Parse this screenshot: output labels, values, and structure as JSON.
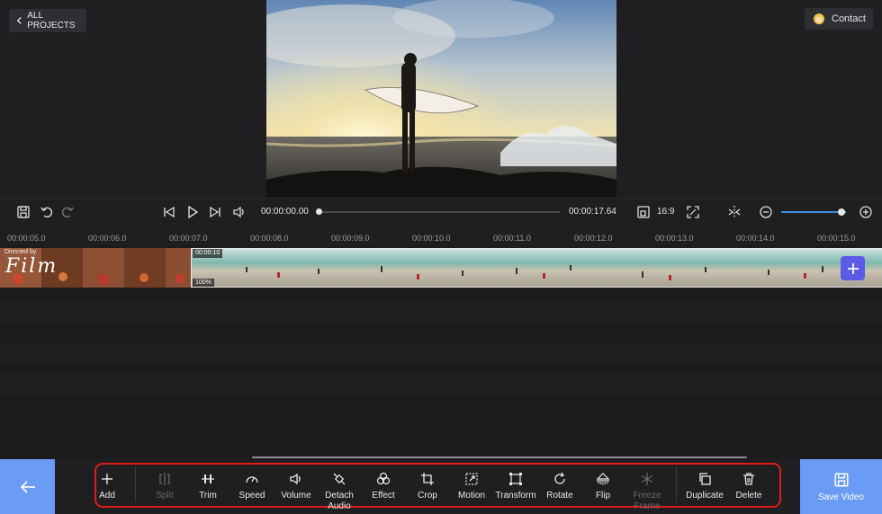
{
  "header": {
    "back_label": "ALL PROJECTS",
    "contact_label": "Contact"
  },
  "player": {
    "current_time": "00:00:00.00",
    "total_time": "00:00:17.64",
    "aspect_ratio": "16:9",
    "playhead_fraction": 0.0,
    "zoom_fraction": 0.93
  },
  "ruler": {
    "labels": [
      "00:00:05.0",
      "00:00:06.0",
      "00:00:07.0",
      "00:00:08.0",
      "00:00:09.0",
      "00:00:10.0",
      "00:00:11.0",
      "00:00:12.0",
      "00:00:13.0",
      "00:00:14.0",
      "00:00:15.0"
    ]
  },
  "timeline": {
    "clip1_text": "Directed by",
    "clip1_title": "Film",
    "clip2_duration": "00:00:10",
    "clip2_volume": "100%"
  },
  "toolbar": {
    "add": "Add",
    "split": "Split",
    "trim": "Trim",
    "speed": "Speed",
    "volume": "Volume",
    "detach_audio": "Detach Audio",
    "effect": "Effect",
    "crop": "Crop",
    "motion": "Motion",
    "transform": "Transform",
    "rotate": "Rotate",
    "flip": "Flip",
    "freeze_frame": "Freeze Frame",
    "duplicate": "Duplicate",
    "delete": "Delete"
  },
  "save_label": "Save Video",
  "colors": {
    "accent": "#6a9cf6",
    "highlight_frame": "#e01b1b",
    "add_clip": "#5b5be8",
    "zoom_track": "#3a8ee6"
  }
}
